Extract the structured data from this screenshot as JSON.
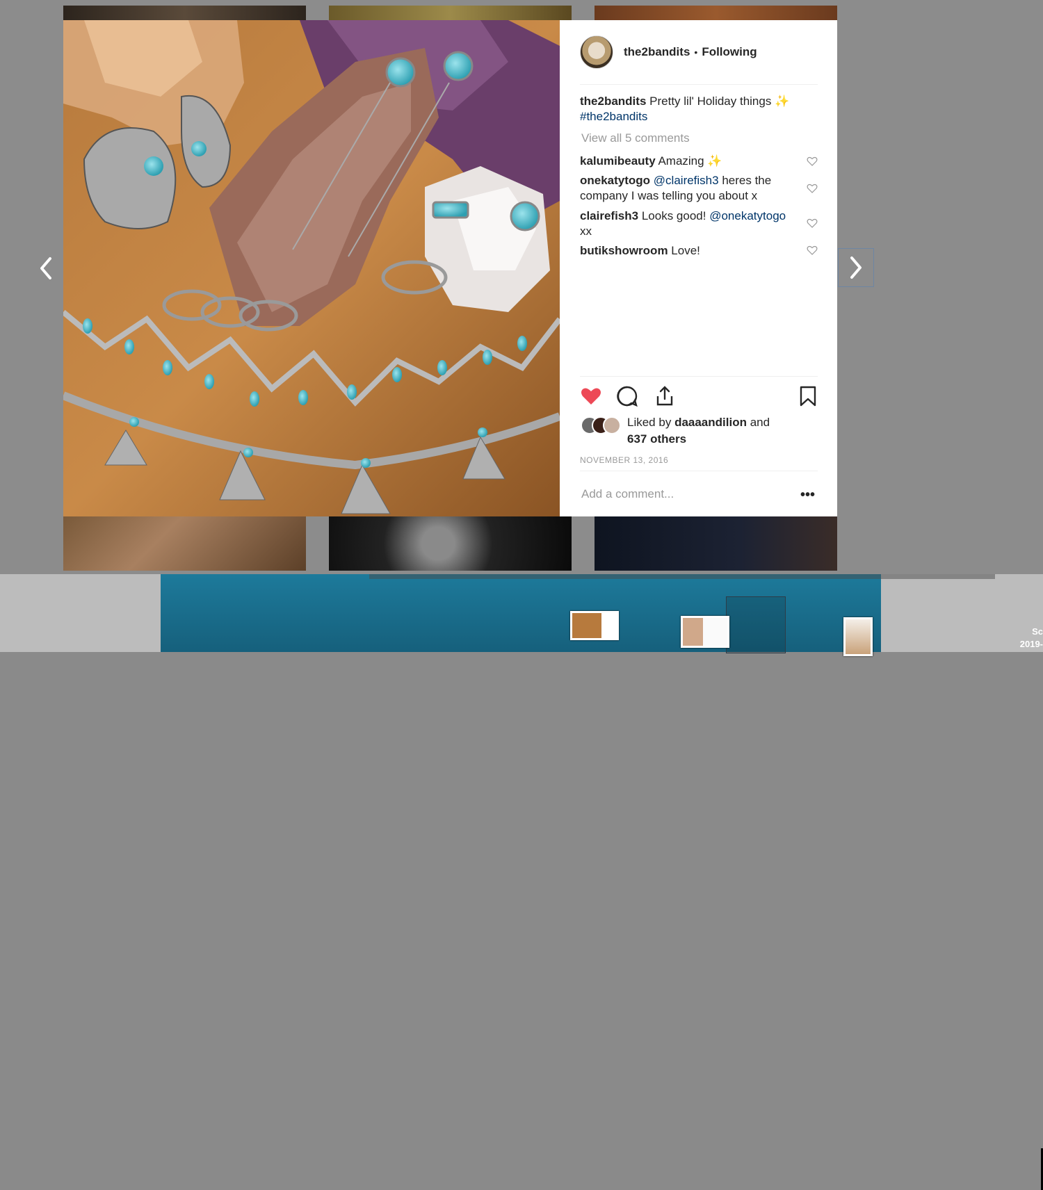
{
  "post": {
    "username": "the2bandits",
    "follow_status": "Following",
    "caption_user": "the2bandits",
    "caption_text": "Pretty lil' Holiday things",
    "caption_emoji": "✨",
    "hashtag": "#the2bandits",
    "view_all": "View all 5 comments",
    "comments": [
      {
        "user": "kalumibeauty",
        "pre": "Amazing",
        "mention": "",
        "post": "",
        "emoji": "✨"
      },
      {
        "user": "onekatytogo",
        "pre": "",
        "mention": "@clairefish3",
        "post": "heres the company I was telling you about x",
        "emoji": ""
      },
      {
        "user": "clairefish3",
        "pre": "Looks good!",
        "mention": "@onekatytogo",
        "post": "xx",
        "emoji": ""
      },
      {
        "user": "butikshowroom",
        "pre": "Love!",
        "mention": "",
        "post": "",
        "emoji": ""
      }
    ],
    "likes_prefix": "Liked by",
    "likes_user": "daaaandilion",
    "likes_and": "and",
    "likes_count": "637 others",
    "date": "NOVEMBER 13, 2016",
    "add_comment_placeholder": "Add a comment...",
    "more": "•••",
    "liked": true
  },
  "icons": {
    "heart": "heart-icon",
    "comment": "comment-icon",
    "share": "share-icon",
    "save": "bookmark-icon",
    "prev": "chevron-left-icon",
    "next": "chevron-right-icon"
  },
  "colors": {
    "like_red": "#ed4956",
    "link_blue": "#003569",
    "muted": "#999999",
    "text": "#262626"
  },
  "screenshot_label": {
    "line1": "Sc",
    "line2": "2019-"
  }
}
